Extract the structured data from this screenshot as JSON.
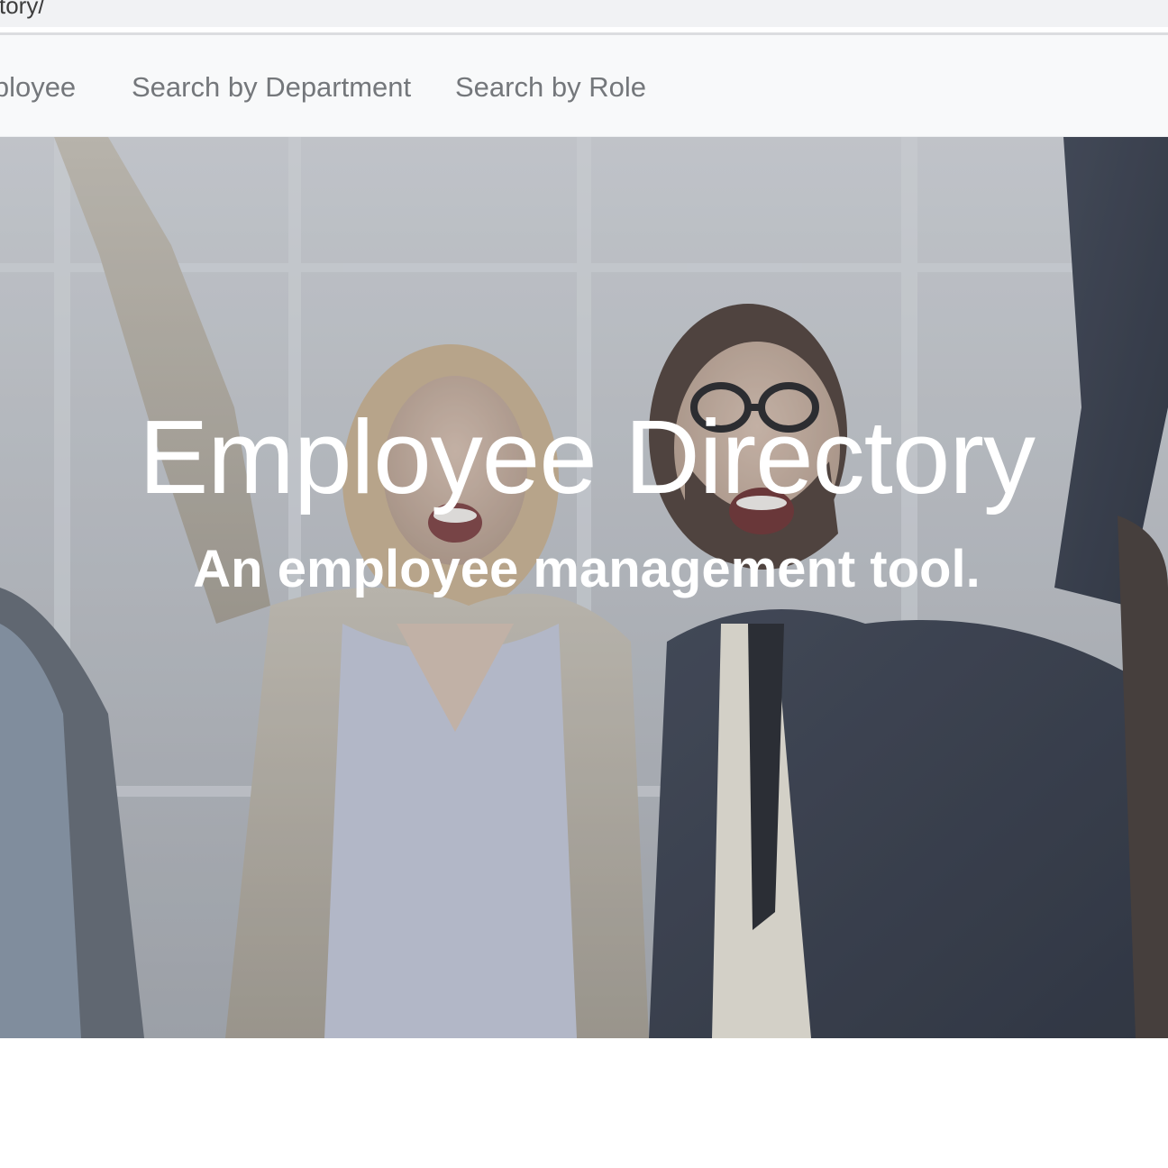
{
  "browser": {
    "url_fragment": "ctory/"
  },
  "navbar": {
    "links": [
      {
        "label": "mployee"
      },
      {
        "label": "Search by Department"
      },
      {
        "label": "Search by Role"
      }
    ]
  },
  "hero": {
    "title": "Employee Directory",
    "subtitle": "An employee management tool.",
    "image": "hero-photo-celebrating-coworkers"
  },
  "colors": {
    "navbar_bg": "#f8f9fa",
    "nav_link": "#74777b",
    "hero_text": "#ffffff"
  }
}
